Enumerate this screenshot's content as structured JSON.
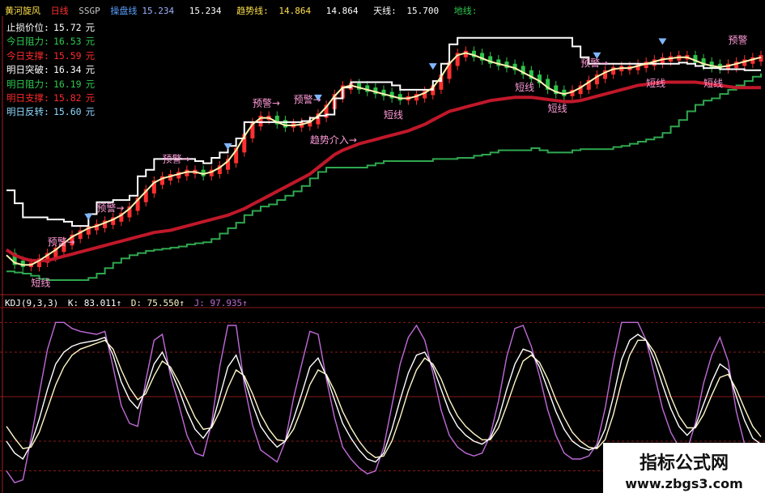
{
  "header": {
    "title": "黄河旋风",
    "period": "日线",
    "code": "SSGP",
    "items": [
      {
        "label": "操盘线",
        "value": "15.234",
        "color": "#ffffff"
      },
      {
        "label": "",
        "value": "15.234",
        "color": "#ffffff"
      },
      {
        "label": "趋势线:",
        "value": "14.864",
        "color": "#ffe14a"
      },
      {
        "label": "",
        "value": "14.864",
        "color": "#ffffff"
      },
      {
        "label": "天线:",
        "value": "15.700",
        "color": "#ffffff"
      },
      {
        "label": "地线:",
        "value": "",
        "color": "#2fc94f"
      }
    ]
  },
  "price_panel": [
    {
      "label": "止损价位:",
      "value": "15.72",
      "unit": "元",
      "color": "#ffffff"
    },
    {
      "label": "今日阻力:",
      "value": "16.53",
      "unit": "元",
      "color": "#2fc94f"
    },
    {
      "label": "今日支撑:",
      "value": "15.59",
      "unit": "元",
      "color": "#ff2a2a"
    },
    {
      "label": "明日突破:",
      "value": "16.34",
      "unit": "元",
      "color": "#ffffff"
    },
    {
      "label": "明日阻力:",
      "value": "16.19",
      "unit": "元",
      "color": "#2fc94f"
    },
    {
      "label": "明日支撑:",
      "value": "15.82",
      "unit": "元",
      "color": "#ff2a2a"
    },
    {
      "label": "明日反转:",
      "value": "15.60",
      "unit": "元",
      "color": "#8fd8ff"
    }
  ],
  "kdj_header": {
    "name": "KDJ(9,3,3)",
    "k": "K: 83.011↑",
    "d": "D: 75.550↑",
    "j": "J: 97.935↑"
  },
  "annotations": {
    "warning": "预警→",
    "short": "短线",
    "trend_entry": "趋势介入→",
    "warning_right": "预警"
  },
  "watermark": {
    "line1": "指标公式网",
    "line2": "www.zbgs3.com"
  },
  "colors": {
    "up": "#ff3030",
    "down": "#2ec44a",
    "heaven": "#ffffff",
    "earth": "#2fa84f",
    "trend": "#c0182a",
    "operate": "#fff3b0",
    "fast": "#8fb8ff",
    "annotation": "#ff9bd8",
    "k": "#ffffff",
    "d": "#fff7c6",
    "j": "#c06ad8",
    "grid": "#8a1a1a"
  },
  "chart_data": [
    {
      "type": "line",
      "panel": "price",
      "series": [
        {
          "name": "天线",
          "values": [
            15.95,
            15.83,
            15.7,
            15.7,
            15.7,
            15.68,
            15.68,
            15.66,
            15.62,
            15.62,
            15.73,
            15.84,
            15.84,
            15.86,
            15.86,
            15.9,
            16.08,
            16.14,
            16.24,
            16.24,
            16.24,
            16.24,
            16.24,
            16.22,
            16.2,
            16.25,
            16.3,
            16.36,
            16.43,
            16.58,
            16.58,
            16.58,
            16.58,
            16.58,
            16.58,
            16.58,
            16.59,
            16.62,
            16.64,
            16.65,
            16.8,
            16.9,
            16.95,
            16.95,
            16.95,
            16.95,
            16.95,
            16.92,
            16.88,
            16.88,
            16.88,
            16.88,
            16.96,
            17.12,
            17.3,
            17.36,
            17.36,
            17.36,
            17.36,
            17.36,
            17.36,
            17.36,
            17.36,
            17.36,
            17.36,
            17.36,
            17.36,
            17.36,
            17.36,
            17.28,
            17.18,
            17.12,
            17.12,
            17.12,
            17.12,
            17.12,
            17.12,
            17.12,
            17.12,
            17.12,
            17.12,
            17.12,
            17.13,
            17.12,
            17.1,
            17.08,
            17.08,
            17.07,
            17.07,
            17.07,
            17.06,
            17.06,
            17.06
          ]
        },
        {
          "name": "地线",
          "values": [
            15.2,
            15.19,
            15.18,
            15.16,
            15.13,
            15.12,
            15.12,
            15.12,
            15.12,
            15.12,
            15.14,
            15.18,
            15.23,
            15.28,
            15.32,
            15.35,
            15.37,
            15.39,
            15.4,
            15.41,
            15.42,
            15.43,
            15.45,
            15.46,
            15.47,
            15.5,
            15.55,
            15.6,
            15.65,
            15.72,
            15.76,
            15.8,
            15.82,
            15.86,
            15.9,
            15.94,
            15.99,
            16.06,
            16.12,
            16.16,
            16.16,
            16.16,
            16.16,
            16.16,
            16.18,
            16.2,
            16.22,
            16.22,
            16.22,
            16.22,
            16.22,
            16.22,
            16.24,
            16.24,
            16.24,
            16.25,
            16.25,
            16.27,
            16.28,
            16.3,
            16.32,
            16.32,
            16.32,
            16.32,
            16.34,
            16.32,
            16.3,
            16.3,
            16.3,
            16.32,
            16.33,
            16.33,
            16.33,
            16.33,
            16.35,
            16.36,
            16.38,
            16.4,
            16.42,
            16.44,
            16.48,
            16.54,
            16.6,
            16.68,
            16.74,
            16.78,
            16.8,
            16.84,
            16.88,
            16.92,
            16.96,
            17.0,
            17.03
          ]
        },
        {
          "name": "趋势线",
          "values": [
            15.4,
            15.35,
            15.32,
            15.3,
            15.3,
            15.3,
            15.32,
            15.34,
            15.36,
            15.38,
            15.4,
            15.42,
            15.44,
            15.46,
            15.48,
            15.5,
            15.52,
            15.54,
            15.56,
            15.57,
            15.58,
            15.6,
            15.62,
            15.64,
            15.66,
            15.68,
            15.7,
            15.72,
            15.75,
            15.78,
            15.82,
            15.86,
            15.9,
            15.94,
            15.98,
            16.02,
            16.06,
            16.1,
            16.16,
            16.22,
            16.28,
            16.32,
            16.35,
            16.38,
            16.4,
            16.42,
            16.44,
            16.46,
            16.48,
            16.5,
            16.53,
            16.56,
            16.6,
            16.64,
            16.68,
            16.7,
            16.72,
            16.74,
            16.76,
            16.78,
            16.79,
            16.8,
            16.81,
            16.81,
            16.81,
            16.8,
            16.79,
            16.78,
            16.77,
            16.77,
            16.78,
            16.8,
            16.82,
            16.84,
            16.86,
            16.88,
            16.9,
            16.92,
            16.93,
            16.94,
            16.95,
            16.95,
            16.95,
            16.95,
            16.95,
            16.94,
            16.93,
            16.92,
            16.91,
            16.9,
            16.9,
            16.9,
            16.9
          ]
        },
        {
          "name": "操盘线",
          "values": [
            15.35,
            15.28,
            15.26,
            15.26,
            15.3,
            15.35,
            15.4,
            15.46,
            15.52,
            15.56,
            15.6,
            15.62,
            15.65,
            15.68,
            15.72,
            15.78,
            15.86,
            15.94,
            16.02,
            16.06,
            16.08,
            16.1,
            16.12,
            16.12,
            16.1,
            16.12,
            16.16,
            16.22,
            16.32,
            16.45,
            16.56,
            16.62,
            16.62,
            16.58,
            16.55,
            16.55,
            16.56,
            16.58,
            16.64,
            16.72,
            16.82,
            16.9,
            16.92,
            16.9,
            16.88,
            16.86,
            16.84,
            16.82,
            16.8,
            16.8,
            16.82,
            16.85,
            16.9,
            17.0,
            17.12,
            17.2,
            17.22,
            17.2,
            17.17,
            17.14,
            17.12,
            17.1,
            17.08,
            17.04,
            17.0,
            16.96,
            16.9,
            16.86,
            16.84,
            16.86,
            16.9,
            16.95,
            17.0,
            17.04,
            17.07,
            17.08,
            17.08,
            17.1,
            17.12,
            17.14,
            17.16,
            17.17,
            17.18,
            17.18,
            17.15,
            17.12,
            17.1,
            17.09,
            17.1,
            17.12,
            17.14,
            17.16,
            17.18
          ]
        }
      ]
    },
    {
      "type": "line",
      "panel": "KDJ(9,3,3)",
      "ylim": [
        -10,
        110
      ],
      "series": [
        {
          "name": "K",
          "values": [
            20,
            12,
            8,
            18,
            35,
            55,
            72,
            80,
            84,
            86,
            87,
            88,
            90,
            78,
            60,
            48,
            42,
            55,
            72,
            80,
            68,
            55,
            40,
            28,
            22,
            30,
            50,
            70,
            78,
            62,
            45,
            30,
            22,
            16,
            20,
            35,
            52,
            70,
            76,
            64,
            48,
            32,
            22,
            14,
            8,
            6,
            12,
            28,
            48,
            66,
            78,
            80,
            70,
            55,
            40,
            30,
            24,
            20,
            18,
            22,
            35,
            55,
            72,
            82,
            80,
            70,
            55,
            40,
            28,
            20,
            16,
            14,
            16,
            28,
            50,
            75,
            88,
            92,
            88,
            75,
            58,
            42,
            30,
            24,
            30,
            45,
            60,
            72,
            68,
            50,
            34,
            22,
            18
          ]
        },
        {
          "name": "D",
          "values": [
            30,
            22,
            15,
            16,
            26,
            42,
            58,
            70,
            78,
            82,
            84,
            86,
            88,
            82,
            68,
            56,
            48,
            52,
            64,
            74,
            70,
            60,
            48,
            36,
            28,
            29,
            40,
            56,
            68,
            64,
            52,
            38,
            28,
            21,
            20,
            28,
            42,
            58,
            68,
            65,
            54,
            40,
            29,
            20,
            13,
            9,
            10,
            20,
            36,
            54,
            68,
            76,
            72,
            62,
            48,
            37,
            30,
            25,
            21,
            21,
            29,
            44,
            60,
            74,
            78,
            73,
            62,
            48,
            36,
            26,
            20,
            16,
            15,
            21,
            38,
            60,
            78,
            88,
            88,
            80,
            66,
            50,
            37,
            29,
            29,
            38,
            51,
            63,
            65,
            55,
            42,
            30,
            23
          ]
        },
        {
          "name": "J",
          "values": [
            0,
            -8,
            -6,
            22,
            52,
            82,
            100,
            100,
            96,
            94,
            93,
            92,
            94,
            70,
            44,
            32,
            30,
            61,
            88,
            92,
            64,
            45,
            24,
            12,
            10,
            32,
            70,
            98,
            98,
            58,
            31,
            14,
            10,
            6,
            20,
            49,
            72,
            94,
            92,
            62,
            36,
            16,
            8,
            2,
            -2,
            0,
            16,
            44,
            72,
            90,
            98,
            88,
            66,
            41,
            24,
            16,
            12,
            10,
            12,
            24,
            47,
            77,
            96,
            98,
            84,
            64,
            41,
            24,
            12,
            8,
            8,
            10,
            18,
            42,
            74,
            100,
            100,
            100,
            88,
            65,
            42,
            26,
            16,
            14,
            32,
            59,
            78,
            90,
            74,
            40,
            18,
            6,
            8
          ]
        }
      ]
    }
  ]
}
